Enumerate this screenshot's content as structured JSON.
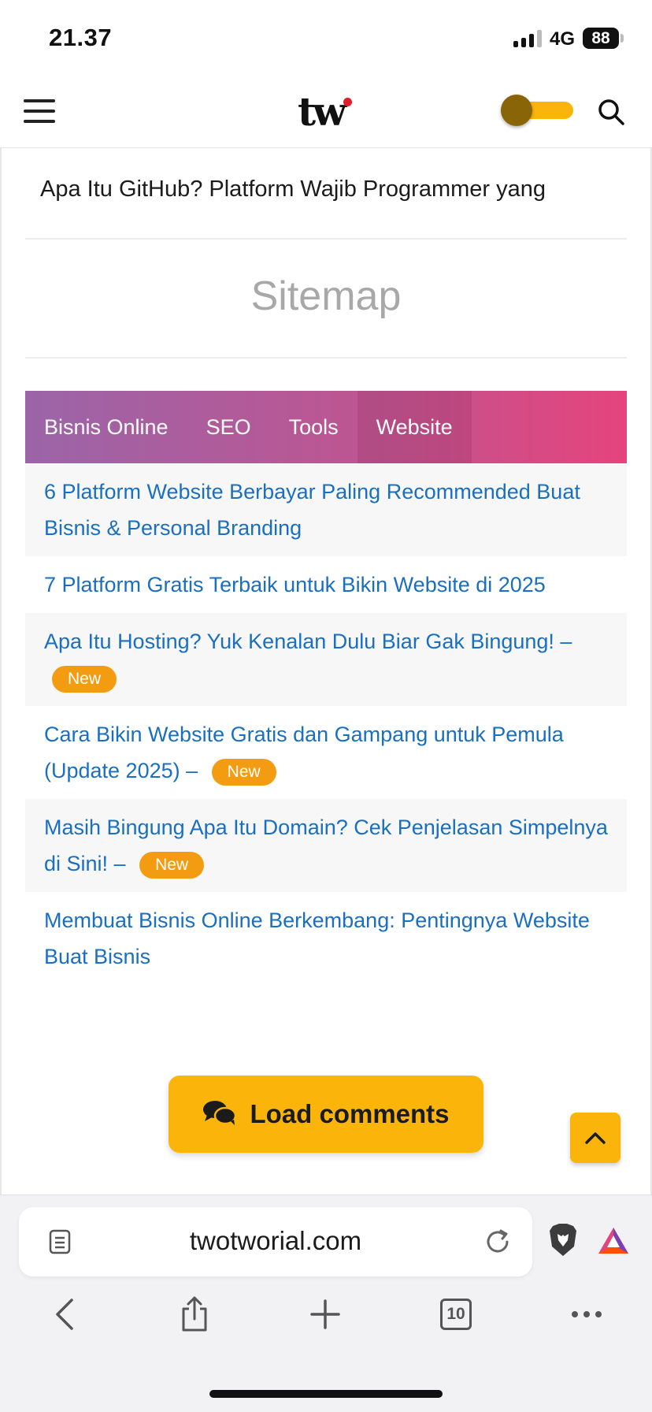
{
  "status_bar": {
    "time": "21.37",
    "network": "4G",
    "battery": "88"
  },
  "header": {
    "logo_text": "tw",
    "brand_accent": "#fbb40a"
  },
  "article": {
    "title_truncated": "Apa Itu GitHub? Platform Wajib Programmer yang"
  },
  "sitemap": {
    "heading": "Sitemap",
    "tabs": [
      {
        "label": "Bisnis Online"
      },
      {
        "label": "SEO"
      },
      {
        "label": "Tools"
      },
      {
        "label": "Website",
        "active": true
      }
    ],
    "items": [
      {
        "text": "6 Platform Website Berbayar Paling Recommended Buat Bisnis & Personal Branding",
        "badge": ""
      },
      {
        "text": "7 Platform Gratis Terbaik untuk Bikin Website di 2025",
        "badge": ""
      },
      {
        "text": "Apa Itu Hosting? Yuk Kenalan Dulu Biar Gak Bingung! –",
        "badge": "New"
      },
      {
        "text": "Cara Bikin Website Gratis dan Gampang untuk Pemula (Update 2025) –",
        "badge": "New"
      },
      {
        "text": "Masih Bingung Apa Itu Domain? Cek Penjelasan Simpelnya di Sini! –",
        "badge": "New"
      },
      {
        "text": "Membuat Bisnis Online Berkembang: Pentingnya Website Buat Bisnis",
        "badge": ""
      }
    ]
  },
  "comments": {
    "load_label": "Load comments"
  },
  "browser": {
    "url": "twotworial.com",
    "tab_count": "10"
  }
}
